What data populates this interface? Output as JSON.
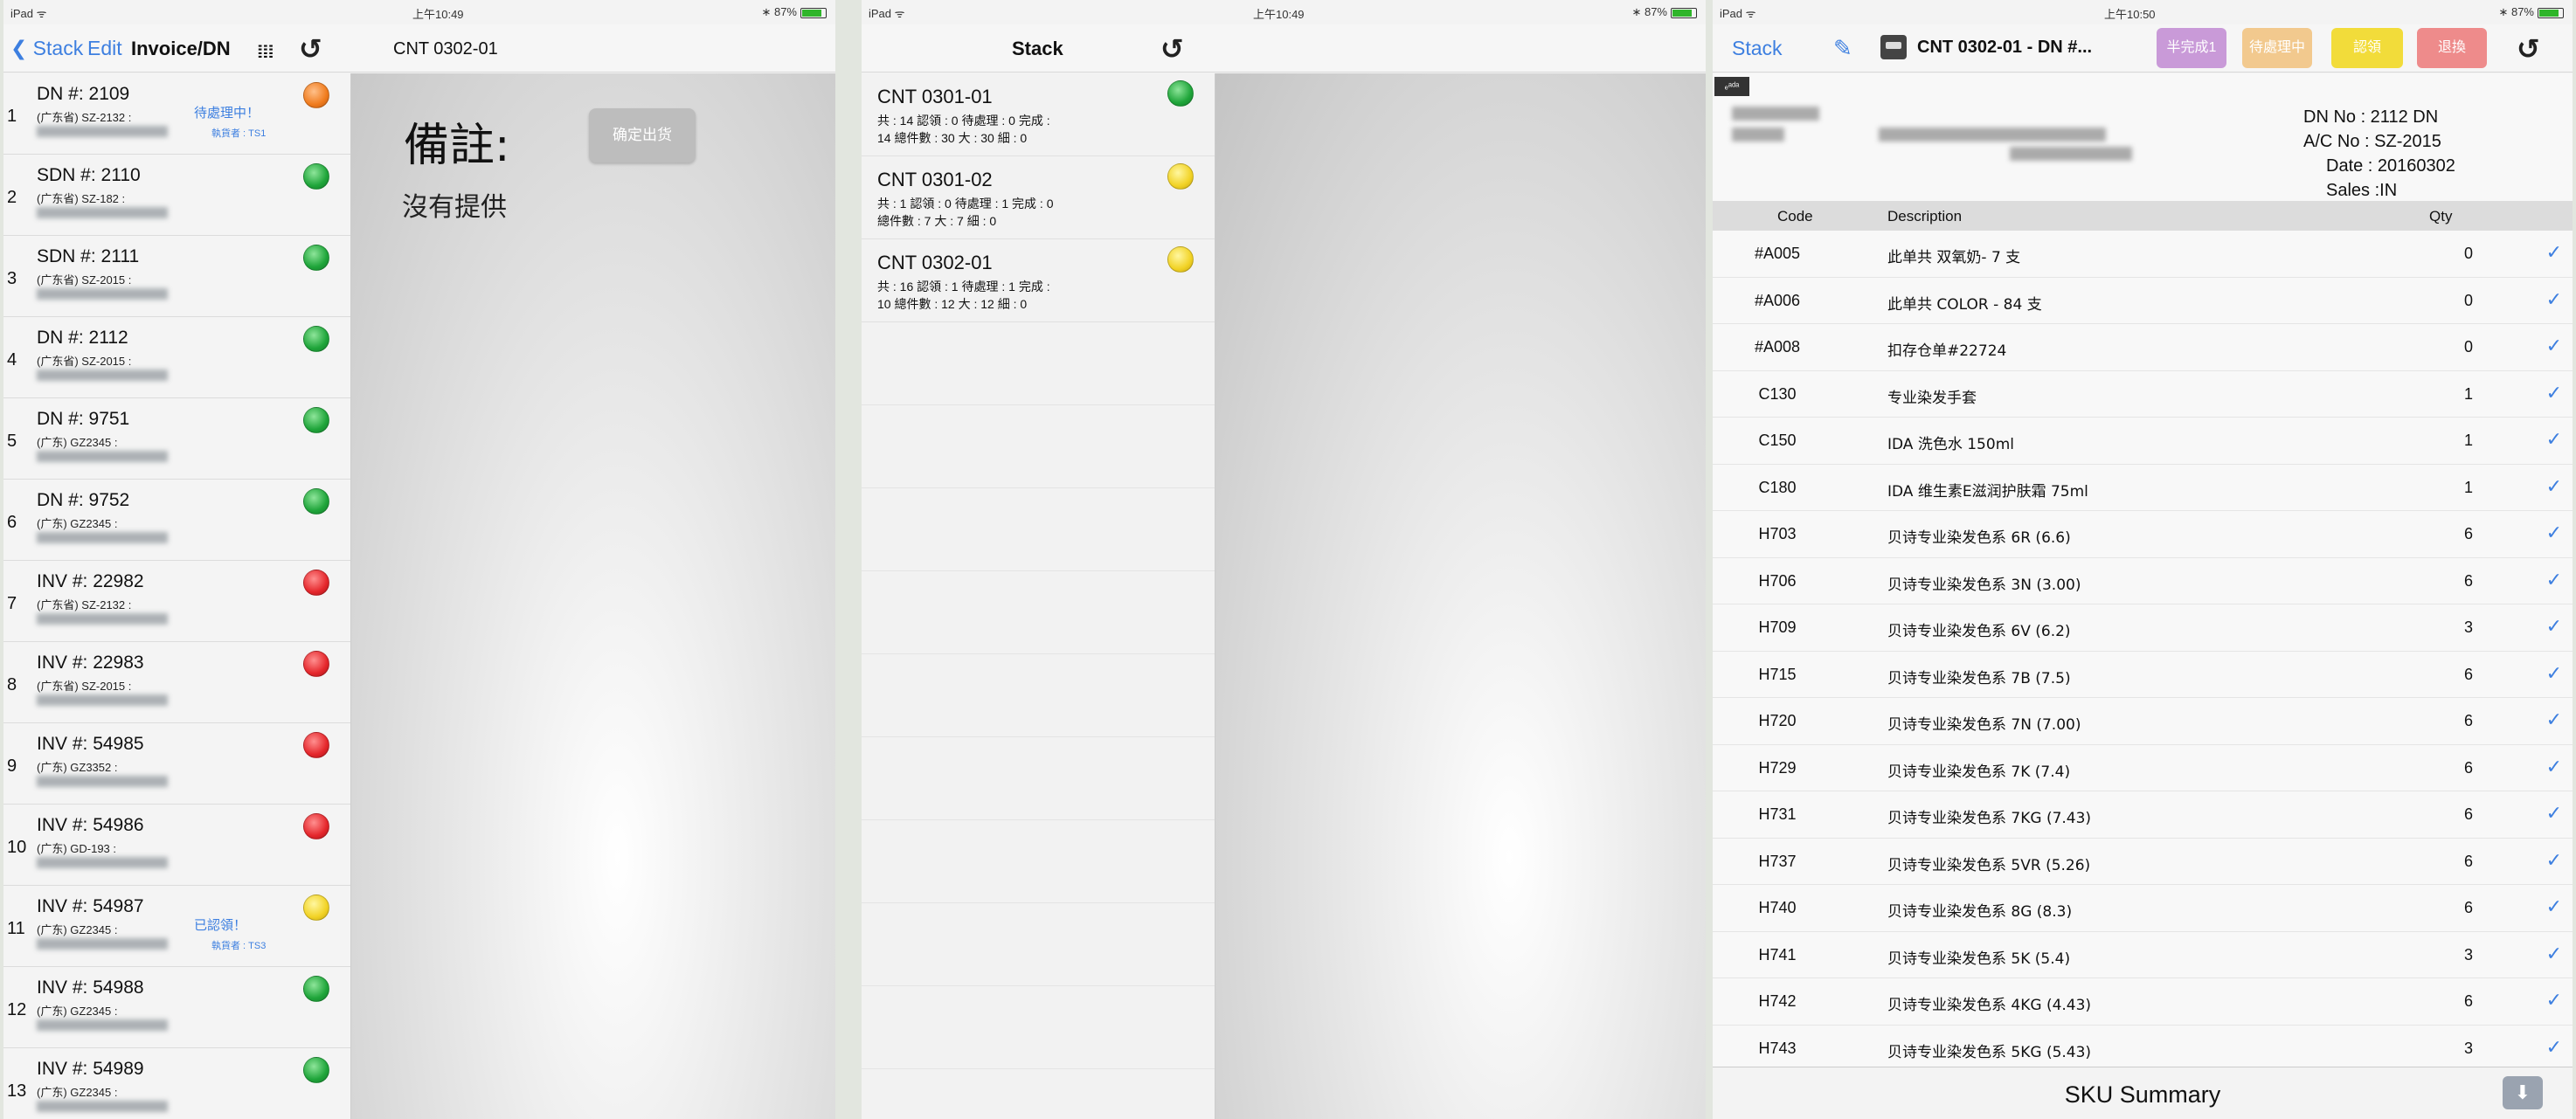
{
  "screen1": {
    "status_left": "iPad ᯤ",
    "status_time": "上午10:49",
    "status_right": "∗ 87%",
    "nav": {
      "back": "Stack",
      "edit": "Edit",
      "title": "Invoice/DN",
      "detail_title": "CNT  0302-01"
    },
    "rows": [
      {
        "idx": "1",
        "title": "DN #: 2109",
        "sub": "(广东省) SZ-2132 :",
        "status": "待處理中！",
        "handler": "執貨者 : TS1",
        "color": "orange"
      },
      {
        "idx": "2",
        "title": "SDN #: 2110",
        "sub": "(广东省) SZ-182 :",
        "status": "",
        "handler": "",
        "color": "green"
      },
      {
        "idx": "3",
        "title": "SDN #: 2111",
        "sub": "(广东省) SZ-2015 :",
        "status": "",
        "handler": "",
        "color": "green"
      },
      {
        "idx": "4",
        "title": "DN #: 2112",
        "sub": "(广东省) SZ-2015 :",
        "status": "",
        "handler": "",
        "color": "green"
      },
      {
        "idx": "5",
        "title": "DN #: 9751",
        "sub": "(广东) GZ2345 :",
        "status": "",
        "handler": "",
        "color": "green"
      },
      {
        "idx": "6",
        "title": "DN #: 9752",
        "sub": "(广东) GZ2345 :",
        "status": "",
        "handler": "",
        "color": "green"
      },
      {
        "idx": "7",
        "title": "INV #: 22982",
        "sub": "(广东省) SZ-2132 :",
        "status": "",
        "handler": "",
        "color": "red"
      },
      {
        "idx": "8",
        "title": "INV #: 22983",
        "sub": "(广东省) SZ-2015 :",
        "status": "",
        "handler": "",
        "color": "red"
      },
      {
        "idx": "9",
        "title": "INV #: 54985",
        "sub": "(广东) GZ3352 :",
        "status": "",
        "handler": "",
        "color": "red"
      },
      {
        "idx": "10",
        "title": "INV #: 54986",
        "sub": "(广东) GD-193 :",
        "status": "",
        "handler": "",
        "color": "red"
      },
      {
        "idx": "11",
        "title": "INV #: 54987",
        "sub": "(广东) GZ2345 :",
        "status": "已認領！",
        "handler": "執貨者 : TS3",
        "color": "yellow"
      },
      {
        "idx": "12",
        "title": "INV #: 54988",
        "sub": "(广东) GZ2345 :",
        "status": "",
        "handler": "",
        "color": "green"
      },
      {
        "idx": "13",
        "title": "INV #: 54989",
        "sub": "(广东) GZ2345 :",
        "status": "",
        "handler": "",
        "color": "green"
      }
    ],
    "memo_title": "備註:",
    "memo_text": "沒有提供",
    "confirm_button": "确定出货"
  },
  "screen2": {
    "status_left": "iPad ᯤ",
    "status_time": "上午10:49",
    "status_right": "∗ 87%",
    "nav_title": "Stack",
    "rows": [
      {
        "title": "CNT  0301-01",
        "line1": "共 : 14  認領 : 0  待處理 : 0  完成 :",
        "line2": "14   總件數 : 30  大 : 30  細 : 0",
        "color": "green"
      },
      {
        "title": "CNT  0301-02",
        "line1": "共 : 1  認領 : 0  待處理 : 1  完成 : 0",
        "line2": "總件數 : 7  大 : 7  細 : 0",
        "color": "yellow"
      },
      {
        "title": "CNT  0302-01",
        "line1": "共 : 16  認領 : 1  待處理 : 1  完成 :",
        "line2": "10   總件數 : 12  大 : 12  細 : 0",
        "color": "yellow"
      }
    ]
  },
  "screen3": {
    "status_left": "iPad ᯤ",
    "status_time": "上午10:50",
    "status_right": "∗ 87%",
    "nav": {
      "back": "Stack",
      "title": "CNT  0302-01 - DN #...",
      "btn_half": "半完成1",
      "btn_pending": "待處理中",
      "btn_claim": "認領",
      "btn_return": "退換"
    },
    "tag": "ₑᵃᵈᵃ",
    "meta": {
      "dn": "DN No : 2112 DN",
      "ac": "A/C No : SZ-2015",
      "date": "Date : 20160302",
      "sales": "Sales :IN"
    },
    "grid_head": {
      "code": "Code",
      "desc": "Description",
      "qty": "Qty"
    },
    "items": [
      {
        "code": "#A005",
        "desc": "此单共 双氧奶-  7  支",
        "qty": "0"
      },
      {
        "code": "#A006",
        "desc": "此单共 COLOR -  84  支",
        "qty": "0"
      },
      {
        "code": "#A008",
        "desc": "扣存仓单#22724",
        "qty": "0"
      },
      {
        "code": "C130",
        "desc": "专业染发手套",
        "qty": "1"
      },
      {
        "code": "C150",
        "desc": "IDA 洗色水 150ml",
        "qty": "1"
      },
      {
        "code": "C180",
        "desc": "IDA 维生素E滋润护肤霜 75ml",
        "qty": "1"
      },
      {
        "code": "H703",
        "desc": "贝诗专业染发色系 6R (6.6)",
        "qty": "6"
      },
      {
        "code": "H706",
        "desc": "贝诗专业染发色系 3N (3.00)",
        "qty": "6"
      },
      {
        "code": "H709",
        "desc": "贝诗专业染发色系 6V (6.2)",
        "qty": "3"
      },
      {
        "code": "H715",
        "desc": "贝诗专业染发色系 7B (7.5)",
        "qty": "6"
      },
      {
        "code": "H720",
        "desc": "贝诗专业染发色系 7N (7.00)",
        "qty": "6"
      },
      {
        "code": "H729",
        "desc": "贝诗专业染发色系 7K (7.4)",
        "qty": "6"
      },
      {
        "code": "H731",
        "desc": "贝诗专业染发色系 7KG (7.43)",
        "qty": "6"
      },
      {
        "code": "H737",
        "desc": "贝诗专业染发色系 5VR (5.26)",
        "qty": "6"
      },
      {
        "code": "H740",
        "desc": "贝诗专业染发色系 8G (8.3)",
        "qty": "6"
      },
      {
        "code": "H741",
        "desc": "贝诗专业染发色系 5K (5.4)",
        "qty": "3"
      },
      {
        "code": "H742",
        "desc": "贝诗专业染发色系 4KG (4.43)",
        "qty": "6"
      },
      {
        "code": "H743",
        "desc": "贝诗专业染发色系 5KG (5.43)",
        "qty": "3"
      }
    ],
    "check_glyph": "✓",
    "footer_label": "SKU Summary"
  },
  "icons": {
    "back": "chevron-left-icon",
    "refresh": "refresh-icon",
    "barcode": "barcode-icon",
    "compose": "compose-icon",
    "printer": "printer-icon",
    "download": "download-icon"
  },
  "colors": {
    "accent": "#3d7fe0",
    "green": "#1fa53a",
    "red": "#e5272c",
    "yellow": "#f2d326",
    "orange": "#f07c1e",
    "btn_half": "#c99ad8",
    "btn_pending": "#f2c98e",
    "btn_claim": "#f2dc3a",
    "btn_return": "#ee8b8b"
  }
}
